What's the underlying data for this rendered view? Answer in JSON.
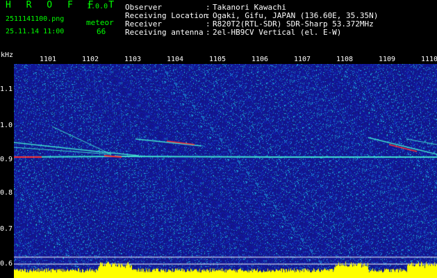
{
  "header": {
    "app_title": "H R O F F T",
    "app_version": "1.0.0",
    "file_name": "2511141100.png",
    "meteor_label": "meteor",
    "date_time": "25.11.14 11:00",
    "meteor_count": "66",
    "info": [
      {
        "label": "Observer",
        "value": "Takanori Kawachi"
      },
      {
        "label": "Receiving Location",
        "value": "Ogaki, Gifu, JAPAN (136.60E, 35.35N)"
      },
      {
        "label": "Receiver",
        "value": "R820T2(RTL-SDR) SDR-Sharp 53.372MHz"
      },
      {
        "label": "Receiving antenna",
        "value": "2el-HB9CV Vertical (el. E-W)"
      }
    ]
  },
  "axis": {
    "y_unit": "kHz",
    "y_ticks": [
      "1.1",
      "1.0",
      "0.9",
      "0.8",
      "0.7",
      "0.6"
    ],
    "x_ticks": [
      "1101",
      "1102",
      "1103",
      "1104",
      "1105",
      "1106",
      "1107",
      "1108",
      "1109",
      "1110"
    ]
  },
  "colors": {
    "background": "#000000",
    "title_green": "#00ff00",
    "spectrogram_base": "#1a1f8c",
    "echo_cyan": "#40e0d0",
    "echo_red": "#ff3030",
    "noise_yellow": "#ffff00"
  }
}
